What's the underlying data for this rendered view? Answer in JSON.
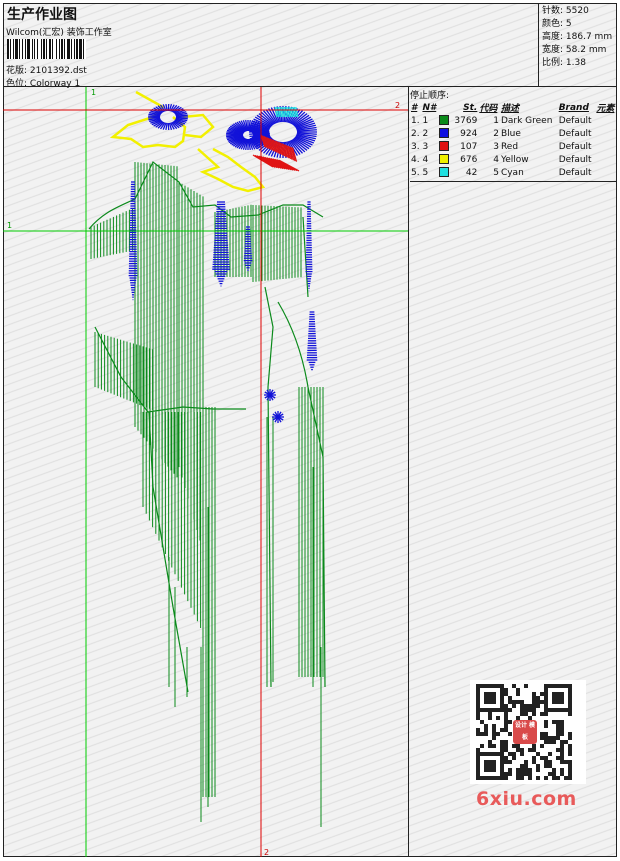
{
  "header": {
    "title": "生产作业图",
    "studio": "Wilcom(汇宏) 装饰工作室",
    "design_label": "花版:",
    "design_file": "2101392.dst",
    "colorway_label": "色位:",
    "colorway": "Colorway 1"
  },
  "stats": {
    "stitches_label": "针数:",
    "stitches": "5520",
    "colors_label": "颜色:",
    "colors": "5",
    "height_label": "高度:",
    "height": "186.7 mm",
    "width_label": "宽度:",
    "width": "58.2 mm",
    "scale_label": "比例:",
    "scale": "1.38"
  },
  "stop_sequence": {
    "heading": "停止顺序:",
    "columns": [
      "#",
      "N#",
      "St.",
      "代码",
      "描述",
      "Brand",
      "元素"
    ],
    "rows": [
      {
        "idx": "1.",
        "n": "1",
        "color": "#0a8a1a",
        "stitches": "3769",
        "code": "1",
        "name": "Dark Green",
        "brand": "Default"
      },
      {
        "idx": "2.",
        "n": "2",
        "color": "#1010e0",
        "stitches": "924",
        "code": "2",
        "name": "Blue",
        "brand": "Default"
      },
      {
        "idx": "3.",
        "n": "3",
        "color": "#e01010",
        "stitches": "107",
        "code": "3",
        "name": "Red",
        "brand": "Default"
      },
      {
        "idx": "4.",
        "n": "4",
        "color": "#f0f000",
        "stitches": "676",
        "code": "4",
        "name": "Yellow",
        "brand": "Default"
      },
      {
        "idx": "5.",
        "n": "5",
        "color": "#20e0e0",
        "stitches": "42",
        "code": "5",
        "name": "Cyan",
        "brand": "Default"
      }
    ]
  },
  "guides": {
    "green_v_label": "1",
    "green_h_label": "1",
    "red_v_label": "2",
    "red_h_label": "2"
  },
  "watermark": "6xiu.com",
  "qr_badge": "设计 模板"
}
